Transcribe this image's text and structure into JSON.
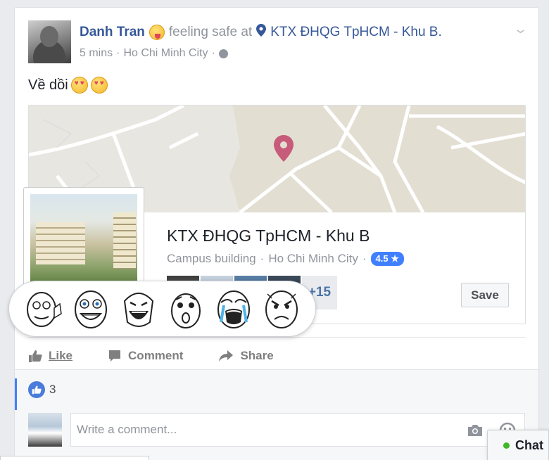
{
  "post": {
    "author": "Danh Tran",
    "feeling": "feeling safe at",
    "place_link": "KTX ĐHQG TpHCM - Khu B.",
    "time": "5 mins",
    "location": "Ho Chi Minh City",
    "separator": "·",
    "text": "Về dồi"
  },
  "place": {
    "name": "KTX ĐHQG TpHCM - Khu B",
    "category": "Campus building",
    "city": "Ho Chi Minh City",
    "separator": "·",
    "rating": "4.5 ★",
    "friends_more": "+15",
    "save_label": "Save"
  },
  "actions": {
    "like": "Like",
    "comment": "Comment",
    "share": "Share"
  },
  "likes": {
    "count": "3"
  },
  "comment": {
    "placeholder": "Write a comment..."
  },
  "chat": {
    "label": "Chat"
  },
  "colors": {
    "link": "#365899",
    "like_blue": "#4080ff",
    "map_pin": "#c75b7a",
    "online": "#42b72a"
  },
  "icons": [
    "tongue-emoji-icon",
    "map-pin-icon",
    "globe-icon",
    "chevron-down-icon",
    "heart-eyes-emoji-icon",
    "like-icon",
    "comment-icon",
    "share-icon",
    "camera-icon",
    "emoji-icon"
  ]
}
